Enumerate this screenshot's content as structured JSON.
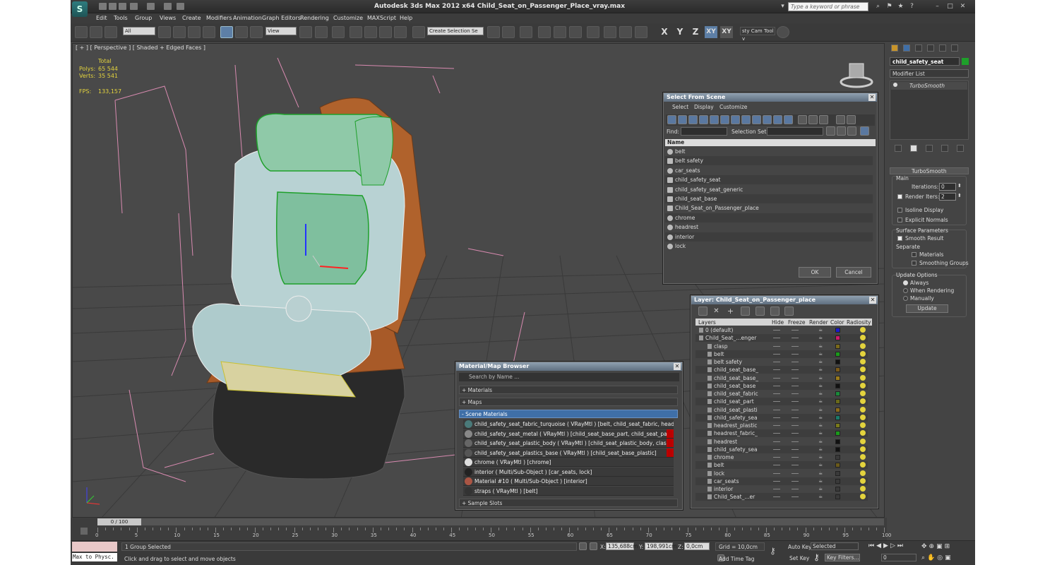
{
  "app": {
    "title": "Autodesk 3ds Max  2012 x64      Child_Seat_on_Passenger_Place_vray.max",
    "logo": "S",
    "search_placeholder": "Type a keyword or phrase"
  },
  "menu": [
    "Edit",
    "Tools",
    "Group",
    "Views",
    "Create",
    "Modifiers",
    "Animation",
    "Graph Editors",
    "Rendering",
    "Customize",
    "MAXScript",
    "Help"
  ],
  "toolbar": {
    "filter": "All",
    "refcoord": "View",
    "selection_set": "Create Selection Se",
    "axes": [
      "X",
      "Y",
      "Z",
      "XY",
      "XY"
    ],
    "cam_tool": "sty Cam Tool v"
  },
  "viewport": {
    "label": "[ + ] [ Perspective ] [ Shaded + Edged Faces ]",
    "stats": {
      "total": "Total",
      "polys_label": "Polys:",
      "polys": "65 544",
      "verts_label": "Verts:",
      "verts": "35 541",
      "fps_label": "FPS:",
      "fps": "133,157"
    }
  },
  "select_from_scene": {
    "title": "Select From Scene",
    "tabs": [
      "Select",
      "Display",
      "Customize"
    ],
    "find_label": "Find:",
    "selset_label": "Selection Set:",
    "col_name": "Name",
    "items": [
      "belt",
      "belt safety",
      "car_seats",
      "child_safety_seat",
      "child_safety_seat_generic",
      "child_seat_base",
      "Child_Seat_on_Passenger_place",
      "chrome",
      "headrest",
      "interior",
      "lock"
    ],
    "ok": "OK",
    "cancel": "Cancel"
  },
  "layer": {
    "title": "Layer: Child_Seat_on_Passenger_place",
    "cols": [
      "Layers",
      "Hide",
      "Freeze",
      "Render",
      "Color",
      "Radiosity"
    ],
    "rows": [
      {
        "name": "0 (default)",
        "color": "#1a1acc"
      },
      {
        "name": "Child_Seat_...enger",
        "color": "#cc1a6a"
      },
      {
        "name": "clasp",
        "color": "#7a6a1a"
      },
      {
        "name": "belt",
        "color": "#1a9a1a"
      },
      {
        "name": "belt safety",
        "color": "#111111"
      },
      {
        "name": "child_seat_base_",
        "color": "#7a5a1a"
      },
      {
        "name": "child_seat_base_",
        "color": "#9a7a1a"
      },
      {
        "name": "child_seat_base",
        "color": "#111111"
      },
      {
        "name": "child_seat_fabric",
        "color": "#1a8a3a"
      },
      {
        "name": "child_seat_part",
        "color": "#6a6a1a"
      },
      {
        "name": "child_seat_plasti",
        "color": "#8a6a1a"
      },
      {
        "name": "child_safety_sea",
        "color": "#1a7a6a"
      },
      {
        "name": "headrest_plastic",
        "color": "#7a7a1a"
      },
      {
        "name": "headrest_fabric_",
        "color": "#1a9a1a"
      },
      {
        "name": "headrest",
        "color": "#111111"
      },
      {
        "name": "child_safety_sea",
        "color": "#111111"
      },
      {
        "name": "chrome",
        "color": "#3a3a3a"
      },
      {
        "name": "belt",
        "color": "#6a5a1a"
      },
      {
        "name": "lock",
        "color": "#3a3a3a"
      },
      {
        "name": "car_seats",
        "color": "#3a3a3a"
      },
      {
        "name": "interior",
        "color": "#3a3a3a"
      },
      {
        "name": "Child_Seat_...er",
        "color": "#3a3a3a"
      }
    ]
  },
  "material_browser": {
    "title": "Material/Map Browser",
    "search": "Search by Name ...",
    "sections": {
      "materials": "+ Materials",
      "maps": "+ Maps",
      "scene": "- Scene Materials",
      "samples": "+ Sample Slots"
    },
    "items": [
      {
        "text": "child_safety_seat_fabric_turquoise ( VRayMtl ) [belt, child_seat_fabric, headrest...",
        "red": false,
        "icon": "#4a7a7a"
      },
      {
        "text": "child_safety_seat_metal ( VRayMtl ) [child_seat_base_part, child_seat_part]",
        "red": true,
        "icon": "#888888"
      },
      {
        "text": "child_safety_seat_plastic_body ( VRayMtl ) [child_seat_plastic_body, clasp, hea...",
        "red": true,
        "icon": "#666666"
      },
      {
        "text": "child_safety_seat_plastics_base ( VRayMtl ) [child_seat_base_plastic]",
        "red": true,
        "icon": "#555555"
      },
      {
        "text": "chrome ( VRayMtl ) [chrome]",
        "red": false,
        "icon": "#dddddd"
      },
      {
        "text": "interior ( Multi/Sub-Object ) [car_seats, lock]",
        "red": false,
        "icon": "#222222"
      },
      {
        "text": "Material #10 ( Multi/Sub-Object ) [interior]",
        "red": false,
        "icon": "#aa5544"
      },
      {
        "text": "straps ( VRayMtl ) [belt]",
        "red": false,
        "icon": "#333333"
      }
    ]
  },
  "cmd": {
    "object": "child_safety_seat",
    "modifier_list": "Modifier List",
    "stack_item": "TurboSmooth",
    "rollout": "TurboSmooth",
    "main": "Main",
    "iterations_label": "Iterations:",
    "iterations": "0",
    "render_iters_label": "Render Iters:",
    "render_iters": "2",
    "isoline": "Isoline Display",
    "explicit": "Explicit Normals",
    "surface": "Surface Parameters",
    "smooth": "Smooth Result",
    "separate": "Separate",
    "materials": "Materials",
    "smoothing": "Smoothing Groups",
    "update_opts": "Update Options",
    "always": "Always",
    "when_rendering": "When Rendering",
    "manually": "Manually",
    "update": "Update"
  },
  "timeline": {
    "frame": "0 / 100",
    "ticks": [
      "0",
      "5",
      "10",
      "15",
      "20",
      "25",
      "30",
      "35",
      "40",
      "45",
      "50",
      "55",
      "60",
      "65",
      "70",
      "75",
      "80",
      "85",
      "90",
      "95",
      "100"
    ]
  },
  "status": {
    "maxscript": "Max to Physc.",
    "selected": "1 Group Selected",
    "prompt": "Click and drag to select and move objects",
    "x_label": "X:",
    "x": "135,688cm",
    "y_label": "Y:",
    "y": "198,991cm",
    "z_label": "Z:",
    "z": "0,0cm",
    "grid": "Grid = 10,0cm",
    "add_time_tag": "Add Time Tag",
    "auto_key": "Auto Key",
    "set_key": "Set Key",
    "selected_dd": "Selected",
    "key_filters": "Key Filters...",
    "frame": "0"
  }
}
